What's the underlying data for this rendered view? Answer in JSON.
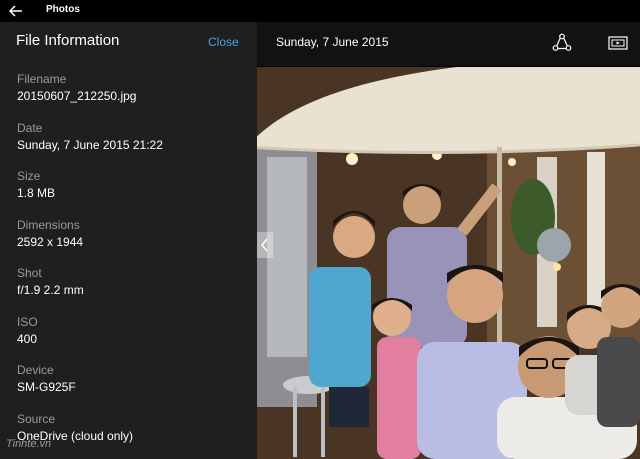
{
  "app": {
    "title": "Photos"
  },
  "panel": {
    "title": "File Information",
    "close_label": "Close",
    "fields": [
      {
        "label": "Filename",
        "value": "20150607_212250.jpg"
      },
      {
        "label": "Date",
        "value": "Sunday, 7 June 2015 21:22"
      },
      {
        "label": "Size",
        "value": "1.8 MB"
      },
      {
        "label": "Dimensions",
        "value": "2592 x 1944"
      },
      {
        "label": "Shot",
        "value": "f/1.9 2.2 mm"
      },
      {
        "label": "ISO",
        "value": "400"
      },
      {
        "label": "Device",
        "value": "SM-G925F"
      },
      {
        "label": "Source",
        "value": "OneDrive (cloud only)"
      }
    ]
  },
  "viewer": {
    "date": "Sunday, 7 June 2015",
    "share_icon": "share-icon",
    "slideshow_icon": "slideshow-icon"
  },
  "watermark": "Tinhte.vn",
  "colors": {
    "accent": "#4aa2e6",
    "panel_bg": "#1f1f1f",
    "label": "#9a9a9a"
  }
}
